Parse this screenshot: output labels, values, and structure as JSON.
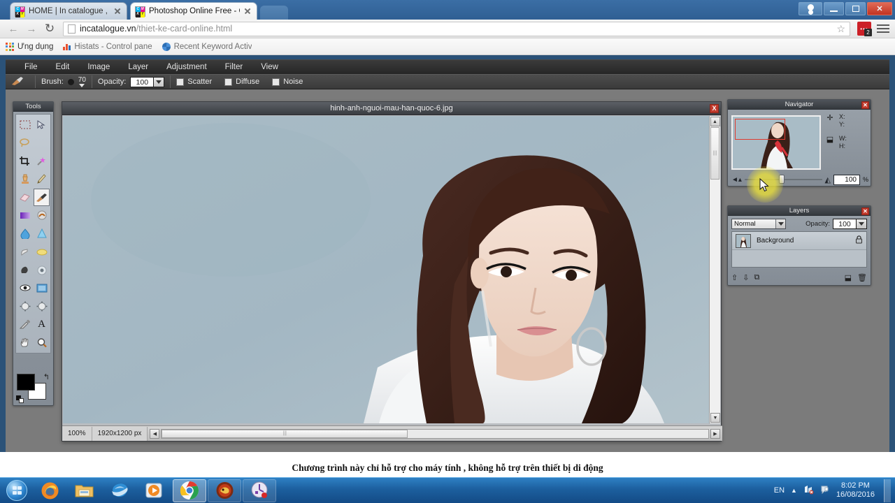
{
  "browser": {
    "tabs": [
      {
        "title": "HOME | In catalogue , In",
        "active": false,
        "favicon": "cmyk-favicon"
      },
      {
        "title": "Photoshop Online Free - C",
        "active": true,
        "favicon": "cmyk-favicon"
      }
    ],
    "window_buttons": {
      "user": "user-icon",
      "minimize": "–",
      "maximize": "❐",
      "close": "✕"
    },
    "nav": {
      "back": "←",
      "forward": "→",
      "reload": "↻"
    },
    "omnibox": {
      "host": "incatalogue.vn",
      "path": "/thiet-ke-card-online.html",
      "star": "☆"
    },
    "extension": {
      "dots": "•••",
      "badge_count": "2"
    },
    "bookmarks": [
      {
        "label": "Ứng dụng",
        "icon": "apps-grid-icon"
      },
      {
        "label": "Histats - Control pane",
        "icon": "bar-chart-icon"
      },
      {
        "label": "Recent Keyword Activ",
        "icon": "globe-icon"
      }
    ]
  },
  "photoshop": {
    "menu": [
      "File",
      "Edit",
      "Image",
      "Layer",
      "Adjustment",
      "Filter",
      "View"
    ],
    "options_bar": {
      "tool_icon": "brush-icon",
      "brush_label": "Brush:",
      "brush_size": "70",
      "opacity_label": "Opacity:",
      "opacity_value": "100",
      "checkboxes": [
        {
          "label": "Scatter",
          "checked": false
        },
        {
          "label": "Diffuse",
          "checked": false
        },
        {
          "label": "Noise",
          "checked": false
        }
      ]
    },
    "tools": {
      "title": "Tools",
      "items": [
        {
          "name": "rectangular-marquee-tool",
          "glyph": "⬚"
        },
        {
          "name": "move-tool",
          "glyph": "➤"
        },
        {
          "name": "lasso-tool",
          "glyph": "❁"
        },
        {
          "name": "lasso-tool-alt",
          "glyph": ""
        },
        {
          "name": "crop-tool",
          "glyph": "⌧"
        },
        {
          "name": "magic-wand-tool",
          "glyph": "✸"
        },
        {
          "name": "clone-stamp-tool",
          "glyph": "♟"
        },
        {
          "name": "pencil-tool",
          "glyph": "✏"
        },
        {
          "name": "eraser-tool",
          "glyph": "▱"
        },
        {
          "name": "brush-tool",
          "glyph": "✐",
          "selected": true
        },
        {
          "name": "gradient-tool",
          "glyph": "▬"
        },
        {
          "name": "smudge-tool",
          "glyph": "◔"
        },
        {
          "name": "blur-tool",
          "glyph": "◆"
        },
        {
          "name": "sharpen-tool",
          "glyph": "▲"
        },
        {
          "name": "dodge-tool",
          "glyph": "☝"
        },
        {
          "name": "sponge-tool",
          "glyph": "☁"
        },
        {
          "name": "burn-tool",
          "glyph": "●"
        },
        {
          "name": "red-eye-tool",
          "glyph": "◎"
        },
        {
          "name": "eye-tool",
          "glyph": "◉"
        },
        {
          "name": "frame-tool",
          "glyph": "▭"
        },
        {
          "name": "pinch-tool",
          "glyph": "⬤"
        },
        {
          "name": "bloat-tool",
          "glyph": "⬤"
        },
        {
          "name": "eyedropper-tool",
          "glyph": "✒"
        },
        {
          "name": "type-tool",
          "glyph": "A"
        },
        {
          "name": "hand-tool",
          "glyph": "✋"
        },
        {
          "name": "zoom-tool",
          "glyph": "⌕"
        }
      ],
      "foreground_color": "#000000",
      "background_color": "#ffffff",
      "swap_icon": "↰"
    },
    "document": {
      "title": "hinh-anh-nguoi-mau-han-quoc-6.jpg",
      "close_label": "X",
      "status": {
        "zoom": "100%",
        "dimensions": "1920x1200 px"
      }
    },
    "navigator": {
      "title": "Navigator",
      "close_label": "✕",
      "x_label": "X:",
      "y_label": "Y:",
      "w_label": "W:",
      "h_label": "H:",
      "x_value": "",
      "y_value": "",
      "w_value": "",
      "h_value": "",
      "zoom_value": "100",
      "percent_label": "%",
      "zoom_out_icon": "zoom-out-icon",
      "zoom_in_icon": "zoom-in-icon"
    },
    "layers": {
      "title": "Layers",
      "close_label": "✕",
      "blend_mode": "Normal",
      "opacity_label": "Opacity:",
      "opacity_value": "100",
      "rows": [
        {
          "name": "Background",
          "locked": true,
          "lock_icon": "🔒"
        }
      ],
      "footer_icons": [
        "move-layer-up-icon",
        "move-layer-down-icon",
        "merge-layer-icon",
        "new-layer-icon",
        "delete-layer-icon"
      ]
    },
    "note": "Chương trình này chỉ hỗ trợ cho máy tính , không hỗ trợ trên thiết bị di động"
  },
  "taskbar": {
    "start": "windows-start-orb",
    "items": [
      {
        "name": "firefox-icon",
        "state": "pinned"
      },
      {
        "name": "windows-explorer-icon",
        "state": "pinned"
      },
      {
        "name": "internet-explorer-icon",
        "state": "pinned"
      },
      {
        "name": "media-player-icon",
        "state": "pinned"
      },
      {
        "name": "google-chrome-icon",
        "state": "active"
      },
      {
        "name": "game-icon",
        "state": "open"
      },
      {
        "name": "clock-gauge-icon",
        "state": "open"
      }
    ],
    "tray": {
      "language": "EN",
      "show_hidden_icon": "▲",
      "network_icon": "network-icon",
      "action_center_icon": "action-center-icon",
      "time": "8:02 PM",
      "date": "16/08/2016"
    }
  },
  "colors": {
    "accent_blue": "#2e80c4",
    "canvas_bg": "#a9bcc6",
    "panel_bg": "#909aa3",
    "close_red": "#c0392b",
    "highlight_yellow": "#ece23c"
  }
}
